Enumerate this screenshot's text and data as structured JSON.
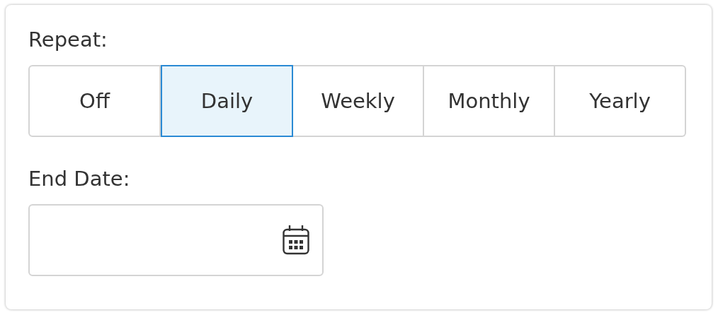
{
  "repeat": {
    "label": "Repeat:",
    "options": [
      {
        "label": "Off",
        "selected": false
      },
      {
        "label": "Daily",
        "selected": true
      },
      {
        "label": "Weekly",
        "selected": false
      },
      {
        "label": "Monthly",
        "selected": false
      },
      {
        "label": "Yearly",
        "selected": false
      }
    ]
  },
  "end_date": {
    "label": "End Date:"
  }
}
